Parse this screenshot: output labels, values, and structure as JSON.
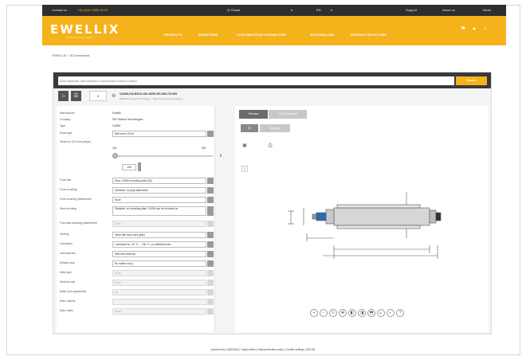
{
  "topbar": {
    "contact": "Contact us",
    "phone": "+46 (0)31 3550 00 00",
    "country": "Global",
    "language": "EN",
    "support": "Support",
    "about": "About us",
    "news": "News"
  },
  "nav": {
    "logo": "EWELLIX",
    "logo_sub": "Reliable Linear Motion",
    "items": [
      "PRODUCTS",
      "INDUSTRIES",
      "CUSTOMIZATION CAPABILITIES",
      "3D DOWNLOAD",
      "PRODUCT SELECTORS"
    ]
  },
  "breadcrumb": "EWELLIX > 3D Download",
  "search": {
    "placeholder": "Enter keywords, part numbers or input product name to search",
    "button": "Search"
  },
  "part": {
    "title": "CASM-100-BS10-100-AD00-ES-M22-T0-000",
    "subtitle": "EWELLIX Linear Technology > High Performance Actuators"
  },
  "params": {
    "rows": [
      {
        "label": "Manufacturer",
        "value": "Ewellix"
      },
      {
        "label": "Company",
        "value": "SKF Motion Technologies"
      },
      {
        "label": "Type",
        "value": "CASM"
      },
      {
        "label": "Screw type",
        "select": "Ball screw 10x10",
        "disabled": false
      },
      {
        "label": "Stroke (or S) in mm (range)",
        "value": "100"
      },
      {
        "label": "Front side",
        "select": "Rear, CASM mounting plate (AD)",
        "disabled": false
      },
      {
        "label": "Front mounting",
        "select": "Standard, no plug attachment",
        "disabled": false
      },
      {
        "label": "Front mounting (attachment)",
        "select": "None",
        "disabled": false
      },
      {
        "label": "Rear mounting",
        "select": "Standard, on mounting plate, CASM can be mounted on",
        "disabled": false
      },
      {
        "label": "Foot plate mounting (attachment)",
        "select": "None",
        "disabled": true
      },
      {
        "label": "Gearing",
        "select": "Inline with servo and gears",
        "disabled": false
      },
      {
        "label": "Lubrication",
        "select": "Lubricated for -30 °C ... +60 °C, no additional lube",
        "disabled": false
      },
      {
        "label": "Limit switches",
        "select": "With limit switches",
        "disabled": false
      },
      {
        "label": "Rotation stop",
        "select": "No rotation stop",
        "disabled": false
      },
      {
        "label": "Motor type",
        "select": "None",
        "disabled": true
      },
      {
        "label": "Gearbox ratio",
        "select": "None",
        "disabled": true
      },
      {
        "label": "Brake (non-adjustment)",
        "select": "No",
        "disabled": true
      },
      {
        "label": "Motor options",
        "select": "",
        "disabled": true
      },
      {
        "label": "Motor cable",
        "select": "None",
        "disabled": true
      }
    ],
    "stroke_min": "100",
    "stroke_max": "600",
    "stroke_value": "100"
  },
  "viewer": {
    "tabs": [
      "Preview",
      "CAD download"
    ],
    "subtabs": [
      "3D",
      "Drawing"
    ]
  },
  "footer": "powered by CADENAS | Legal notice | Data protection policy | Cookie settings | EN-GB"
}
